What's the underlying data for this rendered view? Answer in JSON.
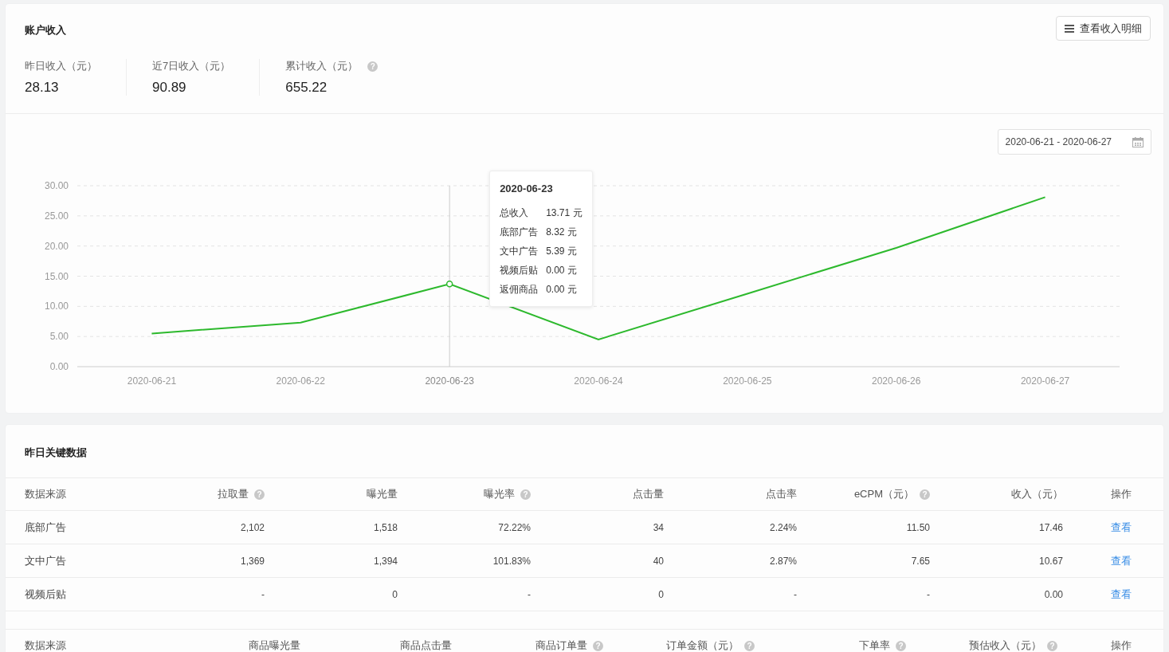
{
  "income_card": {
    "title": "账户收入",
    "detail_button": "查看收入明细",
    "stats": [
      {
        "label": "昨日收入（元）",
        "value": "28.13"
      },
      {
        "label": "近7日收入（元）",
        "value": "90.89"
      },
      {
        "label": "累计收入（元）",
        "value": "655.22",
        "help_icon": "?"
      }
    ],
    "date_range": "2020-06-21 - 2020-06-27",
    "chart_data": {
      "type": "line",
      "grid": true,
      "categories": [
        "2020-06-21",
        "2020-06-22",
        "2020-06-23",
        "2020-06-24",
        "2020-06-25",
        "2020-06-26",
        "2020-06-27"
      ],
      "series": [
        {
          "name": "总收入",
          "color": "#2db92d",
          "values": [
            5.5,
            7.3,
            13.7,
            4.5,
            12.1,
            19.7,
            28.1
          ]
        }
      ],
      "ref_lines": [
        {
          "axis": "x",
          "value": "2020-06-23"
        }
      ],
      "ylim": [
        0,
        30
      ],
      "yticks": [
        {
          "value": 0,
          "label": "0.00"
        },
        {
          "value": 5,
          "label": "5.00"
        },
        {
          "value": 10,
          "label": "10.00"
        },
        {
          "value": 15,
          "label": "15.00"
        },
        {
          "value": 20,
          "label": "20.00"
        },
        {
          "value": 25,
          "label": "25.00"
        },
        {
          "value": 30,
          "label": "30.00"
        }
      ]
    },
    "hover_points": [
      {
        "selected": false
      },
      {
        "selected": false
      },
      {
        "selected": true
      },
      {
        "selected": false
      },
      {
        "selected": false
      },
      {
        "selected": false
      },
      {
        "selected": false
      }
    ],
    "tooltip": {
      "title": "2020-06-23",
      "total_value": "13.71 元",
      "rows": [
        {
          "label": "底部广告",
          "value": "8.32 元"
        },
        {
          "label": "文中广告",
          "value": "5.39 元"
        },
        {
          "label": "视频后贴",
          "value": "0.00 元"
        },
        {
          "label": "返佣商品",
          "value": "0.00 元"
        }
      ]
    }
  },
  "key_data_card": {
    "title": "昨日关键数据",
    "ad_table": {
      "columns": [
        {
          "label": "数据来源"
        },
        {
          "label": "拉取量",
          "help_icon": "?"
        },
        {
          "label": "曝光量"
        },
        {
          "label": "曝光率",
          "help_icon": "?"
        },
        {
          "label": "点击量"
        },
        {
          "label": "点击率"
        },
        {
          "label": "eCPM（元）",
          "help_icon": "?"
        },
        {
          "label": "收入（元）"
        },
        {
          "label": "操作"
        }
      ],
      "rows": [
        {
          "cells": [
            "底部广告",
            "2,102",
            "1,518",
            "72.22%",
            "34",
            "2.24%",
            "11.50",
            "17.46"
          ],
          "action": "查看"
        },
        {
          "cells": [
            "文中广告",
            "1,369",
            "1,394",
            "101.83%",
            "40",
            "2.87%",
            "7.65",
            "10.67"
          ],
          "action": "查看"
        },
        {
          "cells": [
            "视频后贴",
            "-",
            "0",
            "-",
            "0",
            "-",
            "-",
            "0.00"
          ],
          "action": "查看"
        }
      ]
    },
    "product_table": {
      "columns": [
        {
          "label": "数据来源"
        },
        {
          "label": "商品曝光量"
        },
        {
          "label": "商品点击量"
        },
        {
          "label": "商品订单量",
          "help_icon": "?"
        },
        {
          "label": "订单金额（元）",
          "help_icon": "?"
        },
        {
          "label": "下单率",
          "help_icon": "?"
        },
        {
          "label": "预估收入（元）",
          "help_icon": "?"
        },
        {
          "label": "操作"
        }
      ]
    }
  }
}
